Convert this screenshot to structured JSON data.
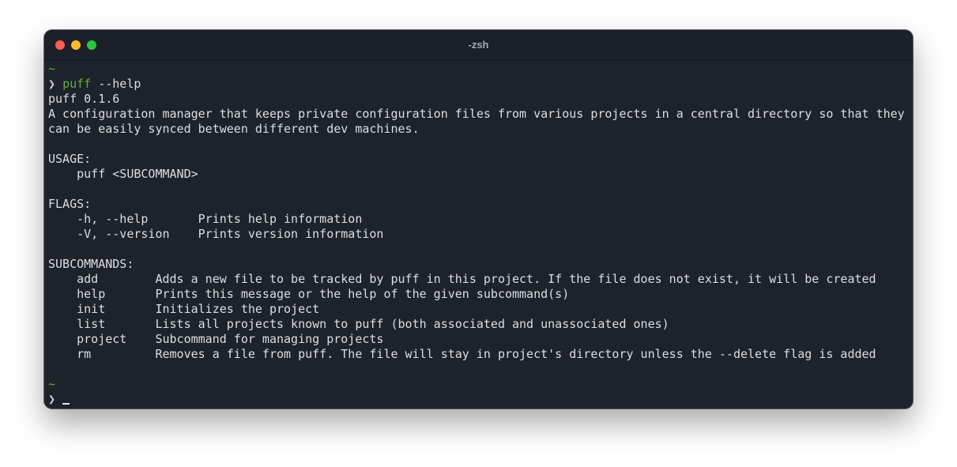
{
  "window": {
    "title": "-zsh"
  },
  "terminal": {
    "tilde": "~",
    "prompt_symbol": "❯",
    "command_name": "puff",
    "command_args": " --help",
    "version_line": "puff 0.1.6",
    "description_line1": "A configuration manager that keeps private configuration files from various projects in a central directory so that they",
    "description_line2": "can be easily synced between different dev machines.",
    "usage_header": "USAGE:",
    "usage_line": "    puff <SUBCOMMAND>",
    "flags_header": "FLAGS:",
    "flags": [
      {
        "line": "    -h, --help       Prints help information"
      },
      {
        "line": "    -V, --version    Prints version information"
      }
    ],
    "subcommands_header": "SUBCOMMANDS:",
    "subcommands": [
      {
        "line": "    add        Adds a new file to be tracked by puff in this project. If the file does not exist, it will be created"
      },
      {
        "line": "    help       Prints this message or the help of the given subcommand(s)"
      },
      {
        "line": "    init       Initializes the project"
      },
      {
        "line": "    list       Lists all projects known to puff (both associated and unassociated ones)"
      },
      {
        "line": "    project    Subcommand for managing projects"
      },
      {
        "line": "    rm         Removes a file from puff. The file will stay in project's directory unless the --delete flag is added"
      }
    ]
  },
  "colors": {
    "background": "#1d222b",
    "titlebar": "#1c2028",
    "text": "#dcdfe4",
    "prompt_green": "#5fb336",
    "close": "#ff5f57",
    "minimize": "#febc2e",
    "maximize": "#28c840"
  }
}
